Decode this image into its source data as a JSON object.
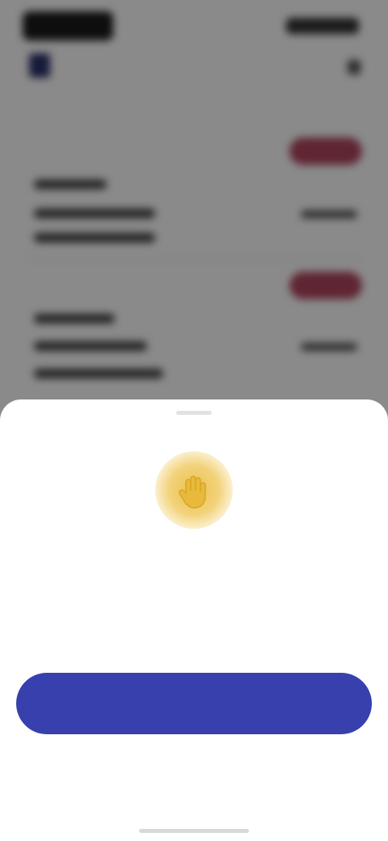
{
  "status_bar": {
    "time": "",
    "icons": [
      "signal-icon",
      "wifi-icon",
      "battery-icon"
    ]
  },
  "header": {
    "back_icon": "back-arrow-icon",
    "menu_icon": "more-options-icon"
  },
  "background_list": {
    "cards": [
      {
        "badge": "",
        "lines": [
          "",
          "",
          ""
        ],
        "value": ""
      },
      {
        "badge": "",
        "lines": [
          "",
          "",
          ""
        ],
        "value": ""
      }
    ]
  },
  "sheet": {
    "icon": "hand-icon",
    "title": "",
    "description": "",
    "primary_button_label": "",
    "secondary_link_label": ""
  },
  "colors": {
    "accent": "#3840ad",
    "badge": "#b0455f",
    "icon_gold": "#ecc04a"
  }
}
